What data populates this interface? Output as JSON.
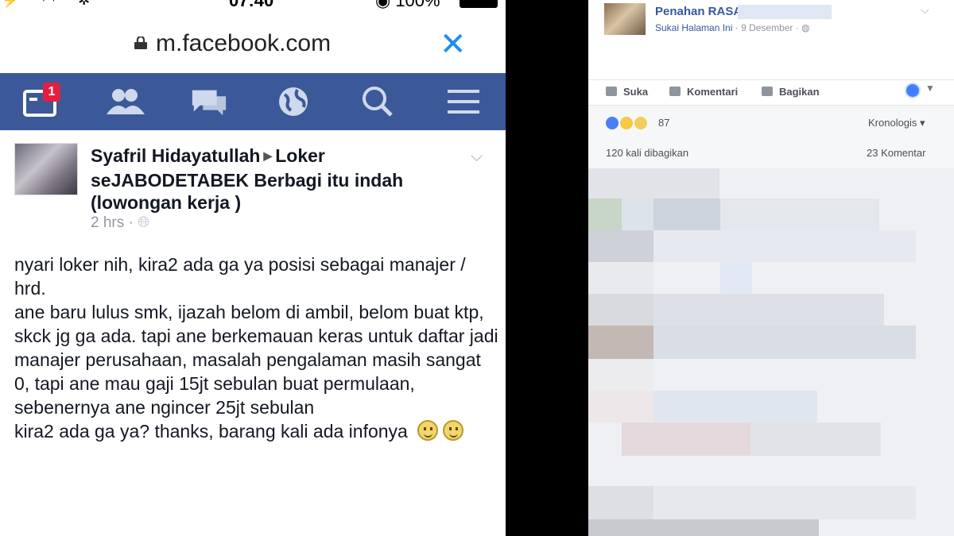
{
  "left_phone": {
    "status_bar": {
      "time": "07:40",
      "battery": "100%"
    },
    "url_bar": {
      "url": "m.facebook.com"
    },
    "nav": {
      "notification_count": "1",
      "items": [
        "news-feed-icon",
        "friends-icon",
        "messages-icon",
        "globe-icon",
        "search-icon",
        "menu-icon"
      ]
    },
    "post": {
      "author": "Syafril Hidayatullah",
      "group": "Loker seJABODETABEK Berbagi itu indah (lowongan kerja )",
      "time": "2 hrs",
      "privacy_icon": "globe-icon",
      "body": "nyari loker nih, kira2 ada ga ya posisi sebagai manajer / hrd.\nane baru lulus smk, ijazah belom di ambil, belom buat ktp, skck jg ga ada. tapi ane berkemauan keras untuk daftar jadi manajer perusahaan, masalah pengalaman masih sangat 0, tapi ane mau gaji 15jt sebulan buat permulaan, sebenernya ane ngincer 25jt sebulan\nkira2 ada ga ya? thanks, barang kali ada infonya"
    }
  },
  "right_desktop": {
    "page_name": "Penahan RASA",
    "like_page": "Sukai Halaman Ini",
    "date": "9 Desember",
    "actions": {
      "like": "Suka",
      "comment": "Komentari",
      "share": "Bagikan"
    },
    "reaction_count": "87",
    "sort": "Kronologis",
    "shares": "120 kali dibagikan",
    "comments": "23 Komentar",
    "colors": {
      "facebook_blue": "#3b5998",
      "link_blue": "#365899"
    }
  }
}
